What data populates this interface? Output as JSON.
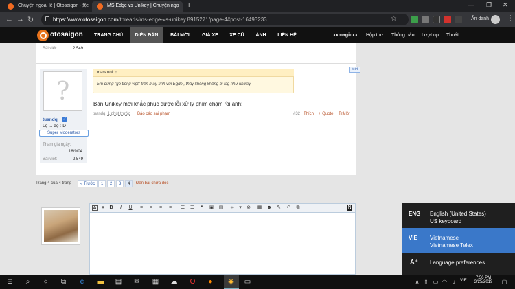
{
  "browser": {
    "tabs": [
      {
        "title": "Chuyện ngoài lề | Otosaigon - Xe"
      },
      {
        "title": "MS Edge vs Unikey | Chuyện ngo"
      }
    ],
    "new_tab": "+",
    "url_host": "https://www.otosaigon.com",
    "url_path": "/threads/ms-edge-vs-unikey.8915271/page-4#post-16493233",
    "profile_label": "Ẩn danh"
  },
  "site": {
    "logo": "otosaigon",
    "nav": [
      "TRANG CHỦ",
      "DIỄN ĐÀN",
      "BÀI MỚI",
      "GIÁ XE",
      "XE CŨ",
      "ẢNH",
      "LIÊN HỆ"
    ],
    "user": "xxmagicxx",
    "user_links": [
      "Hộp thư",
      "Thông báo",
      "Lượt up",
      "Thoát"
    ]
  },
  "prev_post": {
    "posts_label": "Bài viết:",
    "posts_value": "2.549"
  },
  "post": {
    "username": "tuandq",
    "user_title": "Lọ ... đọ :-D",
    "badge": "Super Moderators",
    "joined_label": "Tham gia ngày:",
    "joined_value": "18/9/04",
    "posts_label": "Bài viết:",
    "posts_value": "2.549",
    "quote_author": "mars nói: ↑",
    "quote_text": "Em đừng \"gõ tiếng việt\" trên máy tính với Egde , thấy không không bị lag như unikey",
    "new_badge": "Mới",
    "message": "Bản Unikey mới khắc phục được lỗi xử lý phím chậm rồi anh!",
    "author_link": "tuandq",
    "time": "1 phút trước",
    "report": "Báo cáo sai phạm",
    "number": "#32",
    "actions": [
      "Thích",
      "+ Quote",
      "Trả lời"
    ]
  },
  "pagination": {
    "summary": "Trang 4 của 4 trang",
    "prev": "« Trước",
    "pages": [
      "1",
      "2",
      "3",
      "4"
    ],
    "unread": "Đến bài chưa đọc"
  },
  "language_popup": {
    "items": [
      {
        "code": "ENG",
        "name": "English (United States)",
        "sub": "US keyboard"
      },
      {
        "code": "VIE",
        "name": "Vietnamese",
        "sub": "Vietnamese Telex"
      }
    ],
    "preferences": "Language preferences"
  },
  "taskbar": {
    "lang": "VIE",
    "time": "7:56 PM",
    "date": "3/25/2019"
  },
  "colors": {
    "brand_orange": "#f26b21",
    "selected_lang": "#3a78c9",
    "link_red": "#b8532a"
  }
}
